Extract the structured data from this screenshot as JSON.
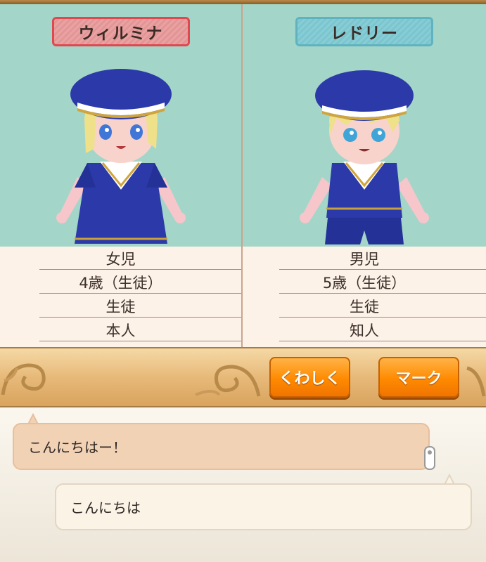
{
  "characters": [
    {
      "name": "ウィルミナ",
      "info": [
        "女児",
        "4歳（生徒）",
        "生徒",
        "本人"
      ]
    },
    {
      "name": "レドリー",
      "info": [
        "男児",
        "5歳（生徒）",
        "生徒",
        "知人"
      ]
    }
  ],
  "actions": {
    "details_label": "くわしく",
    "mark_label": "マーク"
  },
  "chat": {
    "message_left": "こんにちはー！",
    "message_right": "こんにちは"
  },
  "colors": {
    "portrait_bg": "#a3d6c8",
    "name_red_border": "#e0474f",
    "name_teal_border": "#5fb3c0",
    "button_orange": "#ff8a00",
    "uniform_blue": "#2b3aa8"
  }
}
